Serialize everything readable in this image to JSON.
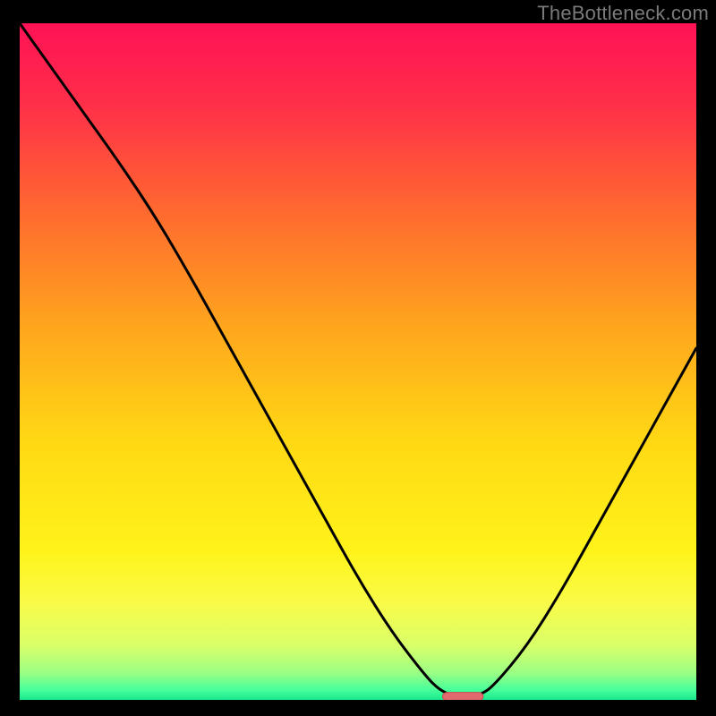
{
  "watermark": "TheBottleneck.com",
  "colors": {
    "frame_bg": "#000000",
    "curve": "#000000",
    "gradient_stops": [
      {
        "offset": 0.0,
        "color": "#ff1255"
      },
      {
        "offset": 0.12,
        "color": "#ff2f49"
      },
      {
        "offset": 0.28,
        "color": "#ff6a2f"
      },
      {
        "offset": 0.45,
        "color": "#ffa61d"
      },
      {
        "offset": 0.62,
        "color": "#ffd914"
      },
      {
        "offset": 0.78,
        "color": "#fff31a"
      },
      {
        "offset": 0.86,
        "color": "#f8fb4a"
      },
      {
        "offset": 0.92,
        "color": "#d8ff69"
      },
      {
        "offset": 0.96,
        "color": "#9bff84"
      },
      {
        "offset": 0.985,
        "color": "#48ff9a"
      },
      {
        "offset": 1.0,
        "color": "#19e88e"
      }
    ],
    "marker_fill": "#e26a6f",
    "marker_stroke": "#c94f55"
  },
  "chart_data": {
    "type": "line",
    "title": "",
    "xlabel": "",
    "ylabel": "",
    "ylim": [
      0,
      100
    ],
    "xlim": [
      0,
      100
    ],
    "x": [
      0,
      5,
      10,
      15,
      20,
      25,
      30,
      35,
      40,
      45,
      50,
      55,
      60,
      62,
      64,
      66,
      68,
      70,
      75,
      80,
      85,
      90,
      95,
      100
    ],
    "values": [
      100,
      93,
      86,
      79,
      71.5,
      63,
      54,
      45,
      36,
      27,
      18,
      10,
      3.5,
      1.5,
      0.6,
      0.5,
      0.7,
      2,
      8,
      16,
      25,
      34,
      43,
      52
    ],
    "marker": {
      "x_center": 65.5,
      "y": 0.5,
      "width": 6,
      "height": 1.2
    },
    "annotations": []
  }
}
